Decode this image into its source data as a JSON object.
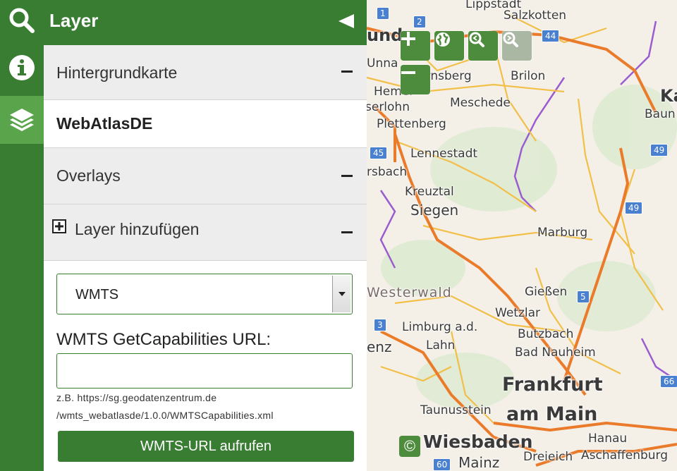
{
  "sidebar": {
    "title": "Layer",
    "rail": [
      {
        "icon": "search-icon"
      },
      {
        "icon": "info-icon"
      },
      {
        "icon": "layers-icon"
      }
    ],
    "sections": {
      "background_map": "Hintergrundkarte",
      "selected_basemap": "WebAtlasDE",
      "overlays": "Overlays",
      "add_layer": "Layer hinzufügen"
    },
    "add_layer_form": {
      "service_type": "WMTS",
      "url_label": "WMTS GetCapabilities URL:",
      "url_value": "",
      "hint_line1": "z.B. https://sg.geodatenzentrum.de",
      "hint_line2": "/wmts_webatlasde/1.0.0/WMTSCapabilities.xml",
      "submit_label": "WMTS-URL aufrufen"
    }
  },
  "map": {
    "controls": [
      "zoom-in",
      "globe",
      "zoom-back",
      "zoom-forward",
      "zoom-out"
    ],
    "copyright_symbol": "©",
    "places": {
      "lippstadt": "Lippstadt",
      "salzkotten": "Salzkotten",
      "arnsberg": "Arnsberg",
      "brilon": "Brilon",
      "meschede": "Meschede",
      "plettenberg": "Plettenberg",
      "lennestadt": "Lennestadt",
      "kreuztal": "Kreuztal",
      "siegen": "Siegen",
      "marburg": "Marburg",
      "westerwald": "Westerwald",
      "giessen": "Gießen",
      "wetzlar": "Wetzlar",
      "limburg": "Limburg a.d.",
      "lahn": "Lahn",
      "butzbach": "Butzbach",
      "bad_nauheim": "Bad Nauheim",
      "frankfurt": "Frankfurt",
      "am_main": "am Main",
      "taunusstein": "Taunusstein",
      "wiesbaden": "Wiesbaden",
      "mainz": "Mainz",
      "hanau": "Hanau",
      "aschaffenburg": "Aschaffenburg",
      "dreieich": "Dreieich",
      "baun": "Baun",
      "ka": "Ka",
      "unna": "Unna",
      "hemer": "Hemer",
      "iserlohn": "serlohn",
      "und": "und",
      "bach": "rsbach",
      "enz": "enz"
    },
    "shields": {
      "a1": "1",
      "a2": "2",
      "a44": "44",
      "a45": "45",
      "a49a": "49",
      "a49b": "49",
      "a3": "3",
      "a5": "5",
      "a60": "60",
      "a66": "66"
    }
  },
  "colors": {
    "primary_green": "#397d33",
    "active_green": "#5aa54c"
  }
}
